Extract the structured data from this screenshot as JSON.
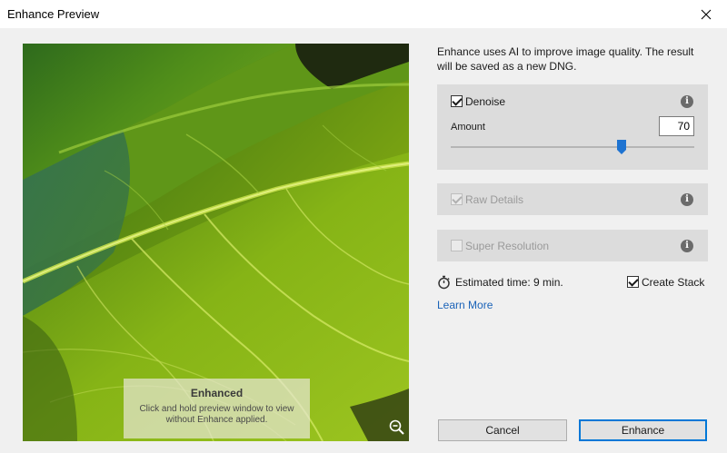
{
  "window": {
    "title": "Enhance Preview",
    "close_icon": "close-icon"
  },
  "preview": {
    "overlay_title": "Enhanced",
    "overlay_hint": "Click and hold preview window to view without Enhance applied.",
    "zoom_icon": "zoom-out-icon"
  },
  "panel": {
    "description": "Enhance uses AI to improve image quality. The result will be saved as a new DNG.",
    "denoise": {
      "label": "Denoise",
      "checked": true,
      "enabled": true,
      "amount_label": "Amount",
      "amount_value": "70",
      "slider_max": 100,
      "info_icon": "info-icon"
    },
    "raw_details": {
      "label": "Raw Details",
      "checked": true,
      "enabled": false,
      "info_icon": "info-icon"
    },
    "super_resolution": {
      "label": "Super Resolution",
      "checked": false,
      "enabled": false,
      "info_icon": "info-icon"
    },
    "estimated_time": "Estimated time: 9 min.",
    "stopwatch_icon": "stopwatch-icon",
    "create_stack": {
      "label": "Create Stack",
      "checked": true
    },
    "learn_more": "Learn More"
  },
  "buttons": {
    "cancel": "Cancel",
    "enhance": "Enhance"
  },
  "colors": {
    "link": "#1b63b8",
    "slider_thumb": "#1e73d1",
    "default_button_border": "#0078d7",
    "card_background": "#dcdcdc"
  }
}
